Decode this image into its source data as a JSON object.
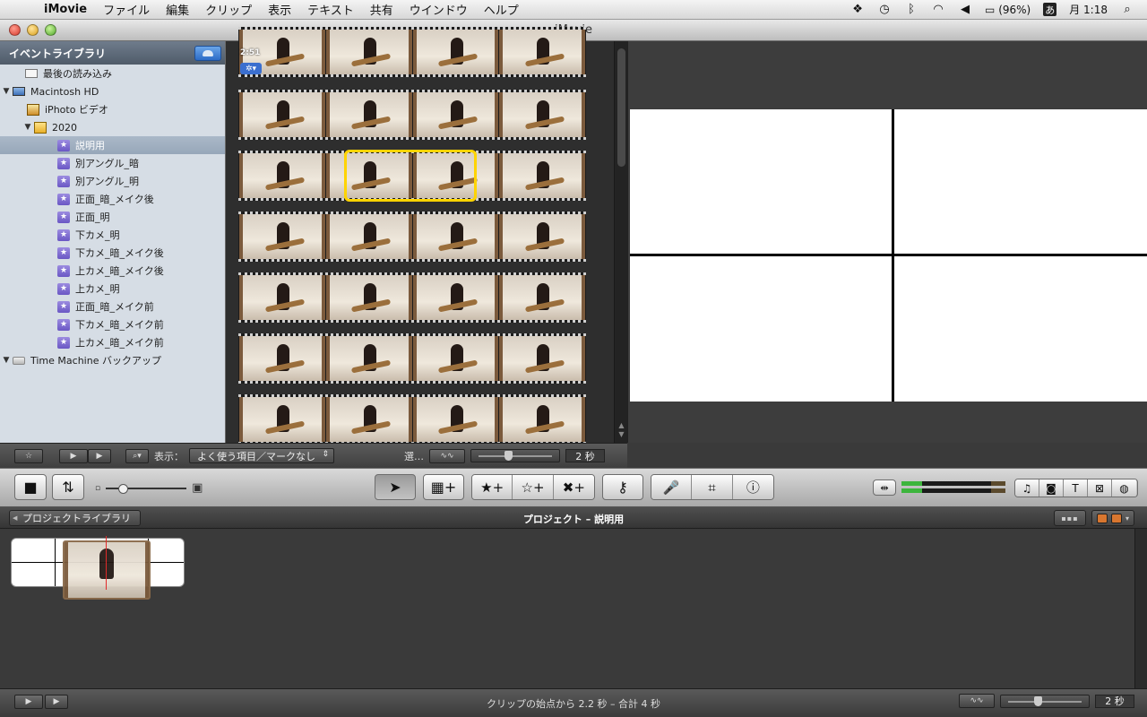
{
  "menubar": {
    "app": "iMovie",
    "items": [
      "ファイル",
      "編集",
      "クリップ",
      "表示",
      "テキスト",
      "共有",
      "ウインドウ",
      "ヘルプ"
    ],
    "battery": "(96%)",
    "ime": "あ",
    "clock": "月 1:18"
  },
  "window": {
    "title": "iMovie"
  },
  "library": {
    "header": "イベントライブラリ",
    "items": {
      "recent": "最後の読み込み",
      "hd": "Macintosh HD",
      "iphoto": "iPhoto ビデオ",
      "year": "2020",
      "ev1": "説明用",
      "ev2": "別アングル_暗",
      "ev3": "別アングル_明",
      "ev4": "正面_暗_メイク後",
      "ev5": "正面_明",
      "ev6": "下カメ_明",
      "ev7": "下カメ_暗_メイク後",
      "ev8": "上カメ_暗_メイク後",
      "ev9": "上カメ_明",
      "ev10": "正面_暗_メイク前",
      "ev11": "下カメ_暗_メイク前",
      "ev12": "上カメ_暗_メイク前",
      "tm": "Time Machine バックアップ"
    }
  },
  "browser": {
    "first_clip_duration": "2:51",
    "show_label": "表示：",
    "show_value": "よく使う項目／マークなし",
    "select_label": "選…",
    "thumb_duration": "2 秒",
    "thumb_slider_fraction": 0.4
  },
  "project": {
    "back_label": "プロジェクトライブラリ",
    "title": "プロジェクト – 説明用",
    "status": "クリップの始点から 2.2 秒 – 合計 4 秒",
    "thumb_duration": "2 秒"
  },
  "toolbar": {
    "icons": [
      "camera-icon",
      "swap-icon",
      "arrow-icon",
      "add-clip-icon",
      "favorite-icon",
      "unfavorite-icon",
      "reject-icon",
      "keyword-icon",
      "voiceover-icon",
      "crop-icon",
      "info-icon",
      "audio-adjust-icon",
      "music-icon",
      "photo-icon",
      "title-icon",
      "transition-icon",
      "map-icon"
    ]
  }
}
